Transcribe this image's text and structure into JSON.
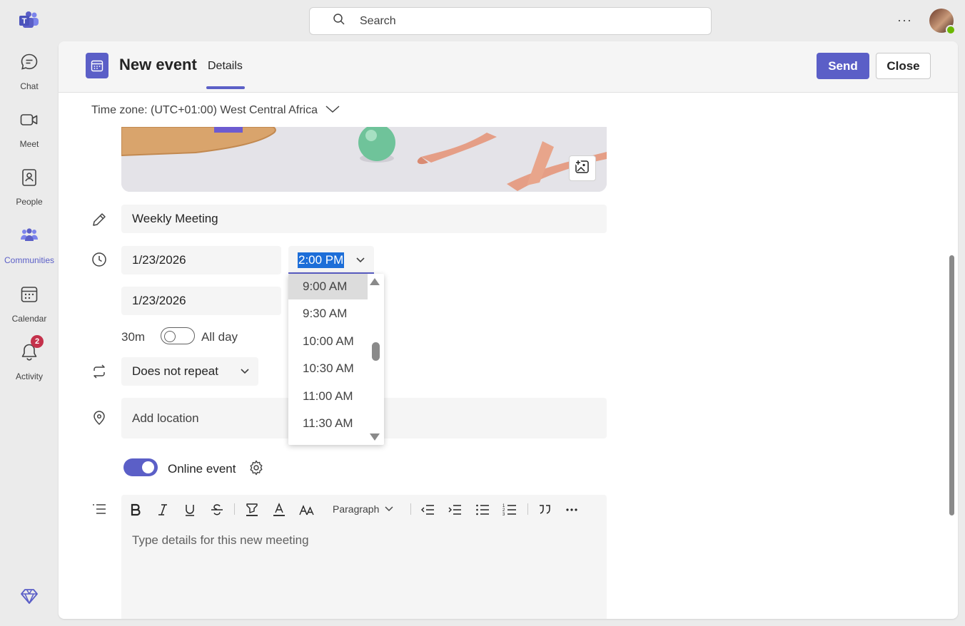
{
  "rail": {
    "items": [
      {
        "label": "Chat",
        "icon": "chat-icon"
      },
      {
        "label": "Meet",
        "icon": "video-icon"
      },
      {
        "label": "People",
        "icon": "contact-book-icon"
      },
      {
        "label": "Communities",
        "icon": "communities-icon"
      },
      {
        "label": "Calendar",
        "icon": "calendar-icon"
      },
      {
        "label": "Activity",
        "icon": "bell-icon",
        "badge": "2"
      }
    ],
    "active": "Communities",
    "accent": "#5b5fc7"
  },
  "topbar": {
    "search_placeholder": "Search",
    "more": "···"
  },
  "event": {
    "title": "New event",
    "tab": "Details",
    "send_label": "Send",
    "close_label": "Close",
    "timezone": "Time zone: (UTC+01:00) West Central Africa",
    "meeting_title": "Weekly Meeting",
    "start_date": "1/23/2026",
    "start_time": "2:00 PM",
    "end_date": "1/23/2026",
    "duration": "30m",
    "all_day_label": "All day",
    "all_day": false,
    "repeat": "Does not repeat",
    "location_placeholder": "Add location",
    "online_label": "Online event",
    "online": true,
    "editor": {
      "paragraph_label": "Paragraph",
      "placeholder": "Type details for this new meeting"
    }
  },
  "time_dropdown": {
    "options": [
      "9:00 AM",
      "9:30 AM",
      "10:00 AM",
      "10:30 AM",
      "11:00 AM",
      "11:30 AM"
    ],
    "highlighted": "9:00 AM"
  },
  "colors": {
    "brand": "#5b5fc7",
    "selection": "#1d6ed8",
    "badge": "#c4314b",
    "presence": "#6bb700"
  }
}
